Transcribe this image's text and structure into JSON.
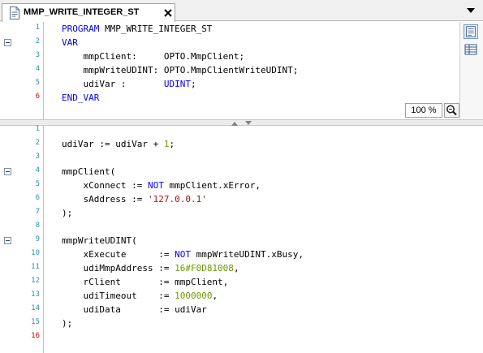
{
  "tab": {
    "title": "MMP_WRITE_INTEGER_ST",
    "doc_icon": "document-icon",
    "close_icon": "close-icon",
    "dropdown_icon": "chevron-down-icon"
  },
  "declaration": {
    "lines": [
      {
        "no": "1",
        "modified": false,
        "fold": false,
        "tokens": [
          {
            "t": "PROGRAM",
            "c": "kw"
          },
          {
            "t": " MMP_WRITE_INTEGER_ST",
            "c": ""
          }
        ]
      },
      {
        "no": "2",
        "modified": false,
        "fold": true,
        "tokens": [
          {
            "t": "VAR",
            "c": "kw"
          }
        ]
      },
      {
        "no": "3",
        "modified": false,
        "fold": false,
        "tokens": [
          {
            "t": "    mmpClient:     OPTO.MmpClient;",
            "c": ""
          }
        ]
      },
      {
        "no": "4",
        "modified": false,
        "fold": false,
        "tokens": [
          {
            "t": "    mmpWriteUDINT: OPTO.MmpClientWriteUDINT;",
            "c": ""
          }
        ]
      },
      {
        "no": "5",
        "modified": false,
        "fold": false,
        "tokens": [
          {
            "t": "    udiVar :       ",
            "c": ""
          },
          {
            "t": "UDINT",
            "c": "kw"
          },
          {
            "t": ";",
            "c": ""
          }
        ]
      },
      {
        "no": "6",
        "modified": true,
        "fold": false,
        "tokens": [
          {
            "t": "END_VAR",
            "c": "kw"
          }
        ]
      }
    ]
  },
  "implementation": {
    "lines": [
      {
        "no": "1",
        "modified": false,
        "fold": false,
        "tokens": []
      },
      {
        "no": "2",
        "modified": false,
        "fold": false,
        "tokens": [
          {
            "t": "udiVar := udiVar + ",
            "c": ""
          },
          {
            "t": "1",
            "c": "num"
          },
          {
            "t": ";",
            "c": ""
          }
        ]
      },
      {
        "no": "3",
        "modified": false,
        "fold": false,
        "tokens": []
      },
      {
        "no": "4",
        "modified": false,
        "fold": true,
        "tokens": [
          {
            "t": "mmpClient(",
            "c": ""
          }
        ]
      },
      {
        "no": "5",
        "modified": false,
        "fold": false,
        "tokens": [
          {
            "t": "    xConnect := ",
            "c": ""
          },
          {
            "t": "NOT",
            "c": "kw"
          },
          {
            "t": " mmpClient.xError,",
            "c": ""
          }
        ]
      },
      {
        "no": "6",
        "modified": false,
        "fold": false,
        "tokens": [
          {
            "t": "    sAddress := ",
            "c": ""
          },
          {
            "t": "'127.0.0.1'",
            "c": "str"
          }
        ]
      },
      {
        "no": "7",
        "modified": false,
        "fold": false,
        "tokens": [
          {
            "t": ");",
            "c": ""
          }
        ]
      },
      {
        "no": "8",
        "modified": false,
        "fold": false,
        "tokens": []
      },
      {
        "no": "9",
        "modified": false,
        "fold": true,
        "tokens": [
          {
            "t": "mmpWriteUDINT(",
            "c": ""
          }
        ]
      },
      {
        "no": "10",
        "modified": false,
        "fold": false,
        "tokens": [
          {
            "t": "    xExecute      := ",
            "c": ""
          },
          {
            "t": "NOT",
            "c": "kw"
          },
          {
            "t": " mmpWriteUDINT.xBusy,",
            "c": ""
          }
        ]
      },
      {
        "no": "11",
        "modified": false,
        "fold": false,
        "tokens": [
          {
            "t": "    udiMmpAddress := ",
            "c": ""
          },
          {
            "t": "16#F0D81008",
            "c": "num"
          },
          {
            "t": ",",
            "c": ""
          }
        ]
      },
      {
        "no": "12",
        "modified": false,
        "fold": false,
        "tokens": [
          {
            "t": "    rClient       := mmpClient,",
            "c": ""
          }
        ]
      },
      {
        "no": "13",
        "modified": false,
        "fold": false,
        "tokens": [
          {
            "t": "    udiTimeout    := ",
            "c": ""
          },
          {
            "t": "1000000",
            "c": "num"
          },
          {
            "t": ",",
            "c": ""
          }
        ]
      },
      {
        "no": "14",
        "modified": false,
        "fold": false,
        "tokens": [
          {
            "t": "    udiData       := udiVar",
            "c": ""
          }
        ]
      },
      {
        "no": "15",
        "modified": false,
        "fold": false,
        "tokens": [
          {
            "t": ");",
            "c": ""
          }
        ]
      },
      {
        "no": "16",
        "modified": true,
        "fold": false,
        "tokens": []
      }
    ]
  },
  "toolbar": {
    "textual_view_icon": "text-view-icon",
    "tabular_view_icon": "table-view-icon",
    "zoom_level": "100 %",
    "zoom_icon": "zoom-icon"
  },
  "colors": {
    "keyword": "#0000ff",
    "number": "#6e9a00",
    "string": "#a31515",
    "line_number": "#2b91af",
    "line_number_modified": "#d00000"
  }
}
